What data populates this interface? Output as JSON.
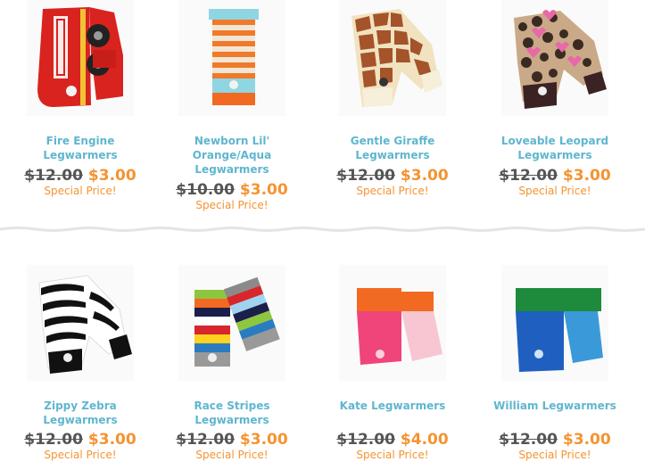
{
  "products": [
    {
      "name_line1": "Fire Engine",
      "name_line2": "Legwarmers",
      "name_line3": "",
      "old_price": "$12.00",
      "new_price": "$3.00",
      "special": "Special Price!",
      "image_icon": "fire-engine-legwarmers-image",
      "colors": {
        "primary": "#d9231f",
        "secondary": "#f2c234"
      }
    },
    {
      "name_line1": "Newborn Lil'",
      "name_line2": "Orange/Aqua",
      "name_line3": "Legwarmers",
      "old_price": "$10.00",
      "new_price": "$3.00",
      "special": "Special Price!",
      "image_icon": "orange-aqua-striped-legwarmers-image",
      "colors": {
        "primary": "#f07a2a",
        "secondary": "#8fd6e2"
      }
    },
    {
      "name_line1": "Gentle Giraffe",
      "name_line2": "Legwarmers",
      "name_line3": "",
      "old_price": "$12.00",
      "new_price": "$3.00",
      "special": "Special Price!",
      "image_icon": "giraffe-legwarmers-image",
      "colors": {
        "primary": "#a5532a",
        "secondary": "#f1e2c0"
      }
    },
    {
      "name_line1": "Loveable Leopard",
      "name_line2": "Legwarmers",
      "name_line3": "",
      "old_price": "$12.00",
      "new_price": "$3.00",
      "special": "Special Price!",
      "image_icon": "leopard-legwarmers-image",
      "colors": {
        "primary": "#3b2a22",
        "secondary": "#e868a8"
      }
    },
    {
      "name_line1": "Zippy Zebra",
      "name_line2": "Legwarmers",
      "name_line3": "",
      "old_price": "$12.00",
      "new_price": "$3.00",
      "special": "Special Price!",
      "image_icon": "zebra-legwarmers-image",
      "colors": {
        "primary": "#111111",
        "secondary": "#ffffff"
      }
    },
    {
      "name_line1": "Race Stripes",
      "name_line2": "Legwarmers",
      "name_line3": "",
      "old_price": "$12.00",
      "new_price": "$3.00",
      "special": "Special Price!",
      "image_icon": "race-stripes-legwarmers-image",
      "colors": {
        "primary": "#d7262d",
        "secondary": "#2b7bc0"
      }
    },
    {
      "name_line1": "Kate Legwarmers",
      "name_line2": "",
      "name_line3": "",
      "old_price": "$12.00",
      "new_price": "$4.00",
      "special": "Special Price!",
      "image_icon": "kate-legwarmers-image",
      "colors": {
        "primary": "#f0457a",
        "secondary": "#f7c6d2"
      }
    },
    {
      "name_line1": "William Legwarmers",
      "name_line2": "",
      "name_line3": "",
      "old_price": "$12.00",
      "new_price": "$3.00",
      "special": "Special Price!",
      "image_icon": "william-legwarmers-image",
      "colors": {
        "primary": "#1f5fc0",
        "secondary": "#1d8a3c"
      }
    }
  ],
  "theme": {
    "link_color": "#5fb6cf",
    "sale_color": "#f59331",
    "old_price_color": "#555555"
  }
}
